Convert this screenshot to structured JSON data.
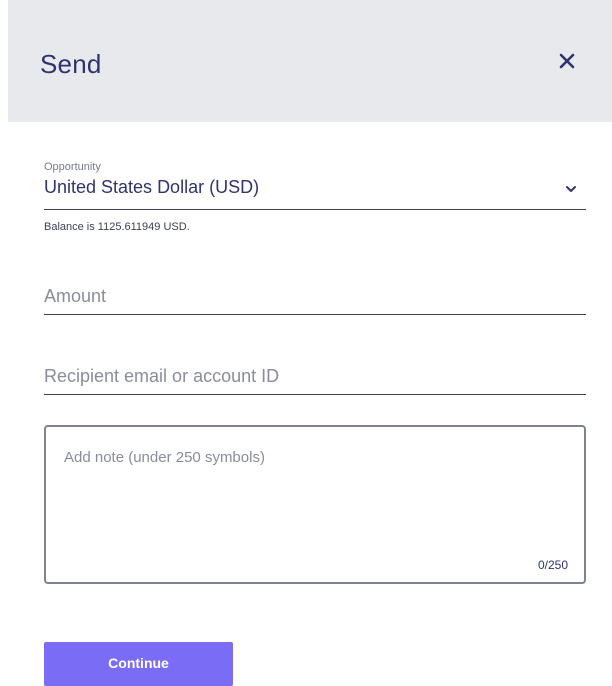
{
  "header": {
    "title": "Send",
    "close_icon": "close-icon"
  },
  "opportunity": {
    "label": "Opportunity",
    "selected": "United States Dollar (USD)",
    "dropdown_icon": "chevron-down-icon"
  },
  "balance_text": "Balance is 1125.611949 USD.",
  "amount": {
    "value": "",
    "placeholder": "Amount"
  },
  "recipient": {
    "value": "",
    "placeholder": "Recipient email or account ID"
  },
  "note": {
    "value": "",
    "placeholder": "Add note (under 250 symbols)",
    "counter": "0/250"
  },
  "continue_label": "Continue",
  "colors": {
    "primary_text": "#2f3370",
    "header_bg": "#e8e9ec",
    "button_bg": "#7b6cf6",
    "button_text": "#ffffff"
  }
}
